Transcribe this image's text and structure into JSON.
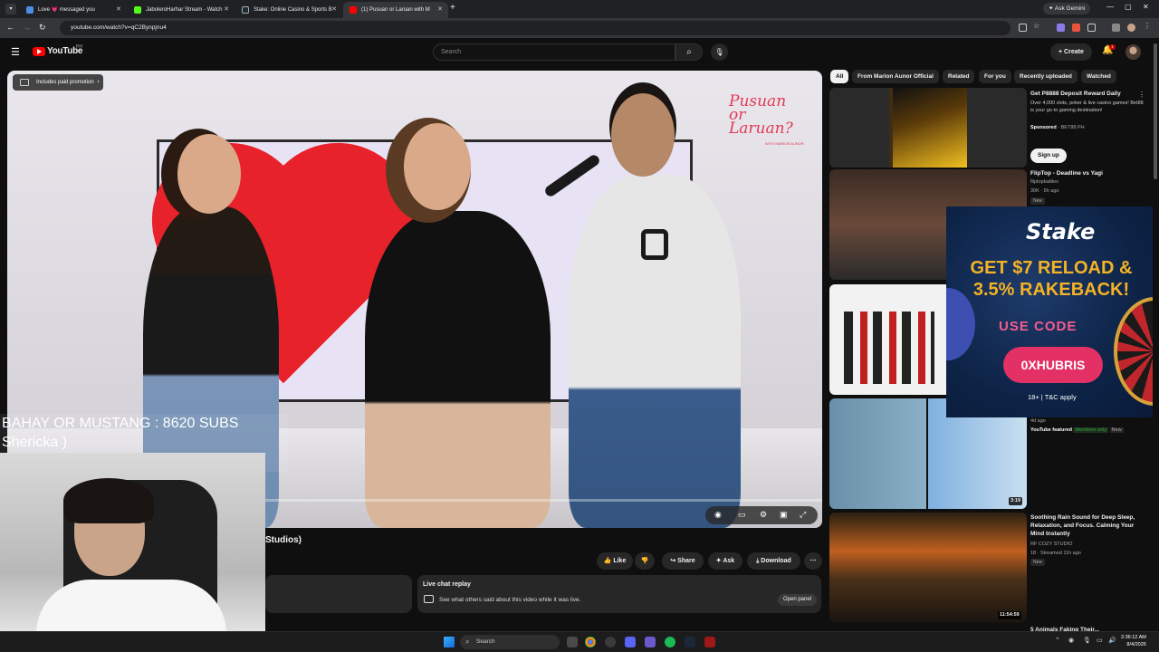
{
  "browser": {
    "tabs": [
      {
        "title": "Love 💗 messaged you",
        "color": "#4a90e2"
      },
      {
        "title": "JaboleroHarhar Stream - Watch",
        "color": "#53fc18"
      },
      {
        "title": "Stake: Online Casino & Sports B",
        "color": "#1a2c38"
      },
      {
        "title": "(1) Pusuan or Laruan with M",
        "color": "#ff0000"
      }
    ],
    "active_tab": 3,
    "new_tab": "+",
    "ask_gemini": "Ask Gemini",
    "url": "youtube.com/watch?v=qC2Bynpjnu4"
  },
  "youtube": {
    "logo_text": "YouTube",
    "country": "PH",
    "search_placeholder": "Search",
    "create_label": "Create",
    "notif_count": "1"
  },
  "player": {
    "promo_chip": "Includes paid promotion",
    "show_logo": "Pusuan or Laruan?",
    "show_logo_sub": "WITH MARION AUNOR",
    "progress": 0.0
  },
  "overlay": {
    "line1": "BAHAY OR MUSTANG : 8620 SUBS",
    "line2": "Shericka )"
  },
  "below": {
    "title_fragment": "Studios)",
    "like": "Like",
    "share": "Share",
    "ask": "Ask",
    "download": "Download",
    "chat_title": "Live chat replay",
    "chat_desc": "See what others said about this video while it was live.",
    "open_panel": "Open panel"
  },
  "chips": [
    "All",
    "From Marion Aunor Official",
    "Related",
    "For you",
    "Recently uploaded",
    "Watched"
  ],
  "recommendations": {
    "ad": {
      "title": "Get P8888 Deposit Reward Daily",
      "desc": "Over 4,000 slots, poker & live casino games! Bet88 is your go-to gaming destination!",
      "sponsor": "Sponsored",
      "sponsor_domain": "BET88.PH",
      "cta": "Sign up"
    },
    "v1": {
      "title": "FlipTop - Deadline vs Yagi",
      "channel": "fliptopbattles",
      "meta": "30K · 5h ago",
      "tag": "New"
    },
    "v3": {
      "meta": "4d ago",
      "badge1": "YouTube featured",
      "badge2": "Members only",
      "badge3": "New",
      "duration": "3:19"
    },
    "v4": {
      "title": "Soothing Rain Sound for Deep Sleep, Relaxation, and Focus. Calming Your Mind Instantly",
      "channel": "RF COZY STUDIO",
      "meta": "18 · Streamed 11h ago",
      "tag": "New",
      "duration": "11:54:59"
    },
    "v5_title": "5 Animals Faking Their..."
  },
  "stake_ad": {
    "logo": "Stake",
    "headline": "GET $7 RELOAD & 3.5% RAKEBACK!",
    "code_label": "USE CODE",
    "code": "0XHUBRIS",
    "terms": "18+ | T&C apply"
  },
  "taskbar": {
    "search": "Search",
    "time": "2:36:12 AM",
    "date": "8/4/2026"
  }
}
